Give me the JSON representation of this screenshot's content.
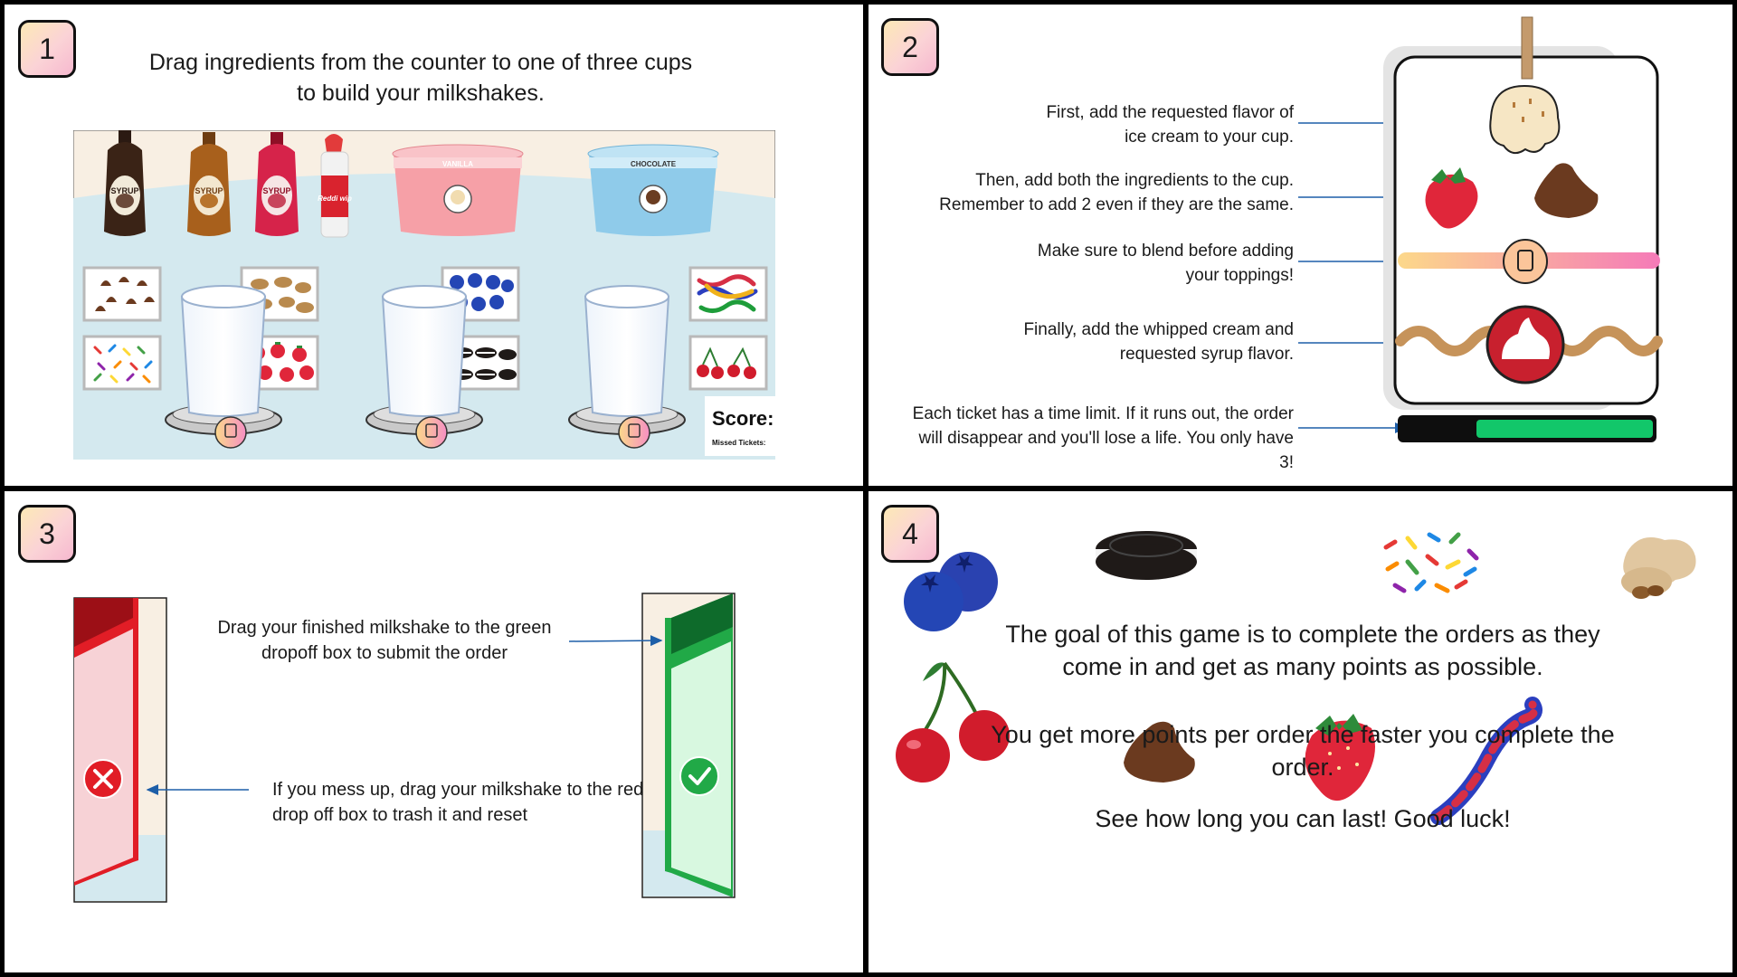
{
  "panels": {
    "p1": {
      "number": "1",
      "instruction": "Drag ingredients from the counter to one of three cups to build your milkshakes.",
      "syrup_label": "SYRUP",
      "whip_label": "Reddi wip",
      "tubs": [
        "VANILLA",
        "CHOCOLATE"
      ],
      "score_label": "Score:",
      "missed_label": "Missed Tickets:"
    },
    "p2": {
      "number": "2",
      "notes": [
        "First, add the requested flavor of ice cream to your cup.",
        "Then, add both the ingredients to the cup. Remember to add 2 even if they are the same.",
        "Make sure to blend before adding your toppings!",
        "Finally, add the whipped cream and requested syrup flavor.",
        "Each ticket has a time limit. If it runs out, the order will disappear and you'll lose a life. You only have 3!"
      ],
      "timer_remaining": 0.7
    },
    "p3": {
      "number": "3",
      "submit_text": "Drag your finished milkshake to the green dropoff box to submit the order",
      "trash_text": "If you mess up, drag your milkshake to the red drop off box to trash it and reset"
    },
    "p4": {
      "number": "4",
      "goal_text": "The goal of this game is to complete the orders as they come in and get as many points as possible.",
      "points_text": "You get more points per order the faster you complete the order.",
      "luck_text": "See how long you can last! Good luck!"
    }
  },
  "colors": {
    "red_box": "#e11d26",
    "green_box": "#21a947",
    "timer_green": "#12c76a",
    "arrow_blue": "#1d5ea8"
  }
}
